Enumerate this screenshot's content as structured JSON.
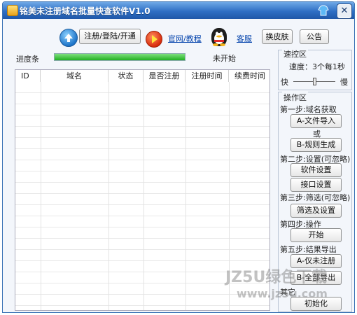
{
  "window": {
    "title": "铭美未注册域名批量快查软件V1.0"
  },
  "titlebar": {
    "skin_icon": "shirt-icon",
    "close_symbol": "✕"
  },
  "toolbar": {
    "register_label": "注册/登陆/开通",
    "website_link": "官网/教程",
    "support_link": "客服",
    "skin_label": "换皮肤",
    "notice_label": "公告"
  },
  "progress": {
    "label": "进度条",
    "value": 1.0,
    "status": "未开始"
  },
  "table": {
    "columns": [
      "ID",
      "域名",
      "状态",
      "是否注册",
      "注册时间",
      "续费时间"
    ],
    "rows": []
  },
  "speed": {
    "title": "速控区",
    "text": "速度：3个每1秒",
    "fast_label": "快",
    "slow_label": "慢",
    "level": 0.5
  },
  "operations": {
    "title": "操作区",
    "step1": "第一步:域名获取",
    "import_button": "A-文件导入",
    "or_text": "或",
    "generate_button": "B-规则生成",
    "step2": "第二步:设置(可忽略)",
    "software_settings_button": "软件设置",
    "interface_settings_button": "接口设置",
    "step3": "第三步:筛选(可忽略)",
    "filter_button": "筛选及设置",
    "step4": "第四步:操作",
    "start_button": "开始",
    "step5": "第五步:结果导出",
    "export_unregistered_button": "A-仅未注册",
    "export_all_button": "B-全部导出",
    "other_label": "其它",
    "init_button": "初始化"
  },
  "watermark": {
    "text": "JZ5U绿色下载",
    "url": "www.jz5u.com"
  }
}
